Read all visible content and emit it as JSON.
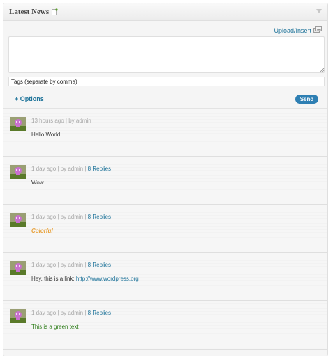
{
  "widget": {
    "title": "Latest News",
    "icons": {
      "feed": "rss-feed-icon",
      "toggle": "collapse-toggle-icon"
    }
  },
  "composer": {
    "upload_label": "Upload/Insert",
    "upload_icon": "media-upload-icon",
    "message_value": "",
    "tags_value": "Tags (separate by comma)",
    "options_label": "+ Options",
    "send_label": "Send"
  },
  "posts": [
    {
      "time": "13 hours ago",
      "sep": " | by ",
      "author": "admin",
      "replies": "",
      "body": "Hello World",
      "body_style": "plain"
    },
    {
      "time": "1 day ago",
      "sep": " | by ",
      "author": "admin",
      "pipe": " | ",
      "replies": "8 Replies",
      "body": "Wow",
      "body_style": "plain"
    },
    {
      "time": "1 day ago",
      "sep": " | by ",
      "author": "admin",
      "pipe": " | ",
      "replies": "8 Replies",
      "body": "Colorful",
      "body_style": "orange"
    },
    {
      "time": "1 day ago",
      "sep": " | by ",
      "author": "admin",
      "pipe": " | ",
      "replies": "8 Replies",
      "body": "Hey, this is a link: ",
      "link": "http://www.wordpress.org",
      "body_style": "link"
    },
    {
      "time": "1 day ago",
      "sep": " | by ",
      "author": "admin",
      "pipe": " | ",
      "replies": "8 Replies",
      "body": "This is a green text",
      "body_style": "green"
    }
  ],
  "colors": {
    "accent": "#21759b",
    "send": "#2e7fb3",
    "orange": "#e8a23c",
    "green": "#2e7d1a"
  }
}
